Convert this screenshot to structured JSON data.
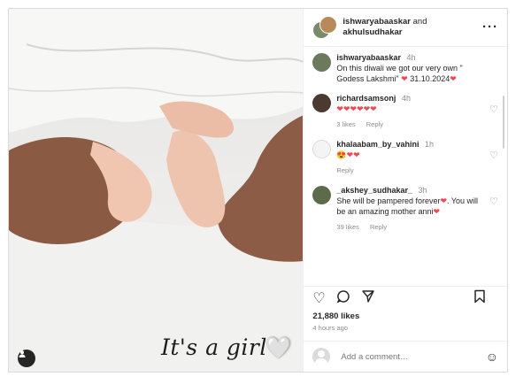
{
  "header": {
    "user1": "ishwaryabaaskar",
    "and_text": "and",
    "user2": "akhulsudhakar",
    "more_icon": "more-horizontal-icon"
  },
  "media": {
    "overlay_caption": "It's a girl",
    "overlay_heart": "🤍",
    "user_tag_icon": "user-tag-icon"
  },
  "comments": [
    {
      "user": "ishwaryabaaskar",
      "time": "4h",
      "text": "On this diwali we got our very own \" Godess Lakshmi\" ❤️ 31.10.2024❤️",
      "likes": "",
      "reply": ""
    },
    {
      "user": "richardsamsonj",
      "time": "4h",
      "text": "❤️❤️❤️❤️❤️❤️",
      "likes": "3 likes",
      "reply": "Reply"
    },
    {
      "user": "khalaabam_by_vahini",
      "time": "1h",
      "text": "😍❤️❤️",
      "likes": "",
      "reply": "Reply"
    },
    {
      "user": "_akshey_sudhakar_",
      "time": "3h",
      "text": "She will be pampered forever❤️. You will be an amazing mother anni❤️",
      "likes": "39 likes",
      "reply": "Reply"
    }
  ],
  "actions": {
    "like_icon": "heart-outline-icon",
    "comment_icon": "comment-icon",
    "share_icon": "send-icon",
    "save_icon": "bookmark-icon"
  },
  "likes_count": "21,880 likes",
  "posted_time": "4 hours ago",
  "add_comment": {
    "placeholder": "Add a comment…",
    "emoji_icon": "emoji-icon"
  },
  "colors": {
    "accent_heart": "#ed4956",
    "text": "#262626",
    "muted": "#8e8e8e",
    "border": "#dbdbdb"
  }
}
